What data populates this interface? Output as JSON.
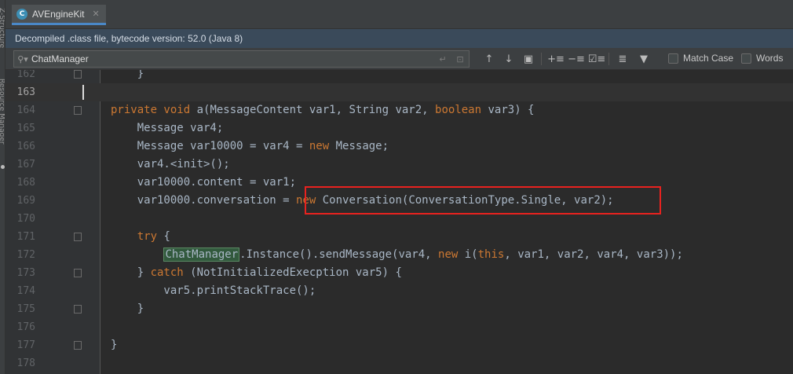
{
  "tab": {
    "icon": "C",
    "title": "AVEngineKit",
    "close": "✕"
  },
  "banner": {
    "text": "Decompiled .class file, bytecode version: 52.0 (Java 8)"
  },
  "findbar": {
    "query": "ChatManager",
    "match_case": "Match Case",
    "words": "Words"
  },
  "icons": {
    "class": "class-c-icon",
    "search": "search-icon",
    "arrow_up": "arrow-up-icon",
    "arrow_down": "arrow-down-icon",
    "filter": "filter-icon"
  },
  "editor": {
    "line_numbers": [
      "162",
      "163",
      "164",
      "165",
      "166",
      "167",
      "168",
      "169",
      "170",
      "171",
      "172",
      "173",
      "174",
      "175",
      "176",
      "177",
      "178"
    ],
    "current_line": "163"
  }
}
